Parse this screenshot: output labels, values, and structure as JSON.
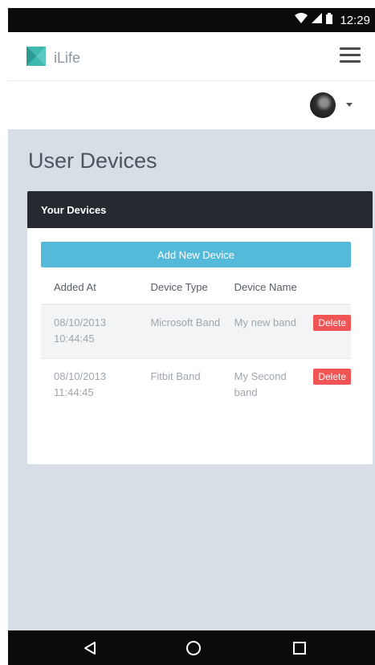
{
  "status_bar": {
    "time": "12:29"
  },
  "header": {
    "app_name": "iLife"
  },
  "page": {
    "title": "User Devices"
  },
  "panel": {
    "title": "Your Devices",
    "add_button_label": "Add New Device",
    "columns": [
      "Added At",
      "Device Type",
      "Device Name"
    ],
    "rows": [
      {
        "added_at": "08/10/2013 10:44:45",
        "device_type": "Microsoft Band",
        "device_name": "My new band",
        "action_label": "Delete"
      },
      {
        "added_at": "08/10/2013 11:44:45",
        "device_type": "Fitbit Band",
        "device_name": "My Second band",
        "action_label": "Delete"
      }
    ]
  },
  "nav": {
    "icons": [
      "back-icon",
      "home-icon",
      "recents-icon"
    ]
  },
  "colors": {
    "accent": "#55b9d9",
    "danger": "#f05455",
    "panel_header": "#262a30",
    "background": "#d8dee6",
    "logo_teal": "#3fb8b0"
  }
}
